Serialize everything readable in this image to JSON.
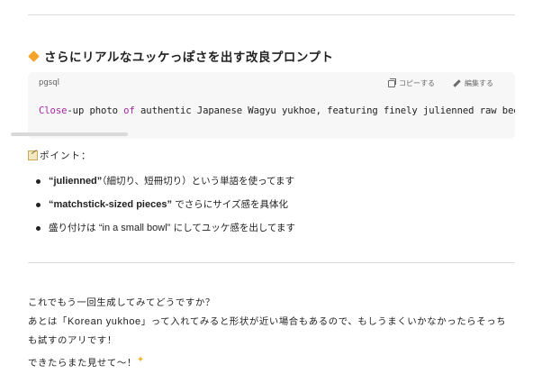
{
  "section_heading": "さらにリアルなユッケっぽさを出す改良プロンプト",
  "code_block": {
    "language": "pgsql",
    "copy_label": "コピーする",
    "edit_label": "編集する",
    "code_keyword_1": "Close",
    "code_part_1": "-up photo ",
    "code_keyword_2": "of",
    "code_part_2": " authentic Japanese Wagyu yukhoe, featuring finely julienned raw beef st"
  },
  "points": {
    "label": "ポイント：",
    "items": [
      {
        "bold": "“julienned”",
        "rest": "（細切り、短冊切り）という単語を使ってます"
      },
      {
        "bold": "“matchstick-sized pieces”",
        "rest": " でさらにサイズ感を具体化"
      },
      {
        "prefix": "盛り付けは ",
        "english": "“in a small bowl”",
        "rest": " にしてユッケ感を出してます"
      }
    ]
  },
  "closing": {
    "line1": "これでもう一回生成してみてどうですか？",
    "line2_a": "あとは「",
    "line2_en": "Korean yukhoe",
    "line2_b": "」って入れてみると形状が近い場合もあるので、もしうまくいかなかったらそっち",
    "line3": "も試すのアリです！",
    "line4": "できたらまた見せて～！"
  }
}
